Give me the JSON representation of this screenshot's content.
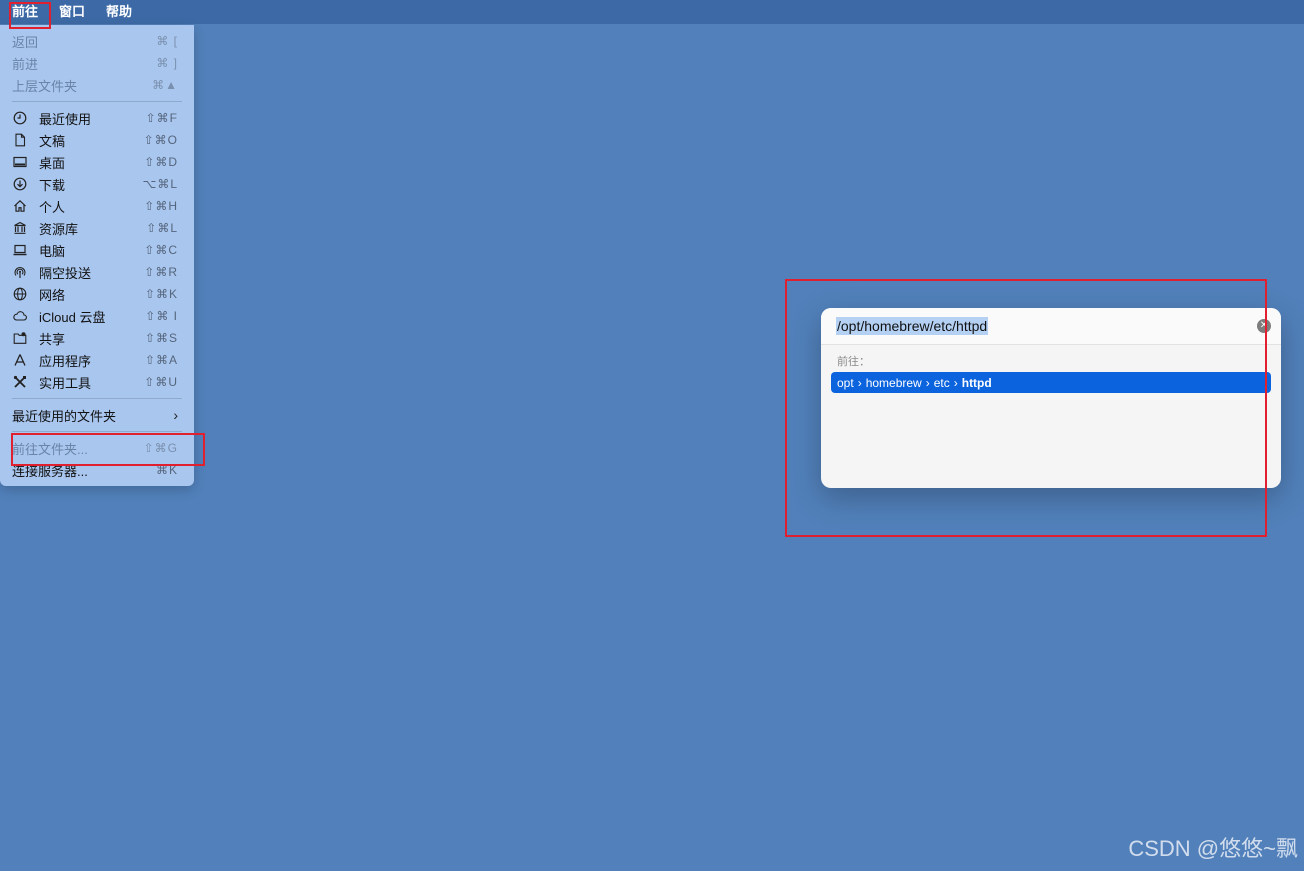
{
  "menubar": {
    "items": [
      "前往",
      "窗口",
      "帮助"
    ]
  },
  "menu": {
    "nav": [
      {
        "label": "返回",
        "shortcut": "⌘ ["
      },
      {
        "label": "前进",
        "shortcut": "⌘ ]"
      },
      {
        "label": "上层文件夹",
        "shortcut": "⌘▲"
      }
    ],
    "places": [
      {
        "label": "最近使用",
        "shortcut": "⇧⌘F",
        "icon": "clock-icon"
      },
      {
        "label": "文稿",
        "shortcut": "⇧⌘O",
        "icon": "document-icon"
      },
      {
        "label": "桌面",
        "shortcut": "⇧⌘D",
        "icon": "desktop-icon"
      },
      {
        "label": "下载",
        "shortcut": "⌥⌘L",
        "icon": "download-icon"
      },
      {
        "label": "个人",
        "shortcut": "⇧⌘H",
        "icon": "home-icon"
      },
      {
        "label": "资源库",
        "shortcut": "⇧⌘L",
        "icon": "library-icon"
      },
      {
        "label": "电脑",
        "shortcut": "⇧⌘C",
        "icon": "computer-icon"
      },
      {
        "label": "隔空投送",
        "shortcut": "⇧⌘R",
        "icon": "airdrop-icon"
      },
      {
        "label": "网络",
        "shortcut": "⇧⌘K",
        "icon": "network-icon"
      },
      {
        "label": "iCloud 云盘",
        "shortcut": "⇧⌘ I",
        "icon": "cloud-icon"
      },
      {
        "label": "共享",
        "shortcut": "⇧⌘S",
        "icon": "shared-folder-icon"
      },
      {
        "label": "应用程序",
        "shortcut": "⇧⌘A",
        "icon": "applications-icon"
      },
      {
        "label": "实用工具",
        "shortcut": "⇧⌘U",
        "icon": "utilities-icon"
      }
    ],
    "recent_folders": "最近使用的文件夹",
    "goto_folder": {
      "label": "前往文件夹...",
      "shortcut": "⇧⌘G"
    },
    "connect_server": {
      "label": "连接服务器...",
      "shortcut": "⌘K"
    }
  },
  "dialog": {
    "path_value": "/opt/homebrew/etc/httpd",
    "section_label": "前往：",
    "result_segments": [
      "opt",
      "homebrew",
      "etc",
      "httpd"
    ],
    "separator": "›"
  },
  "watermark": "CSDN @悠悠~飘",
  "colors": {
    "desktop": "#5180ba",
    "menu": "#a9c6ee",
    "highlight": "#e0202e",
    "selection": "#0b63de"
  }
}
